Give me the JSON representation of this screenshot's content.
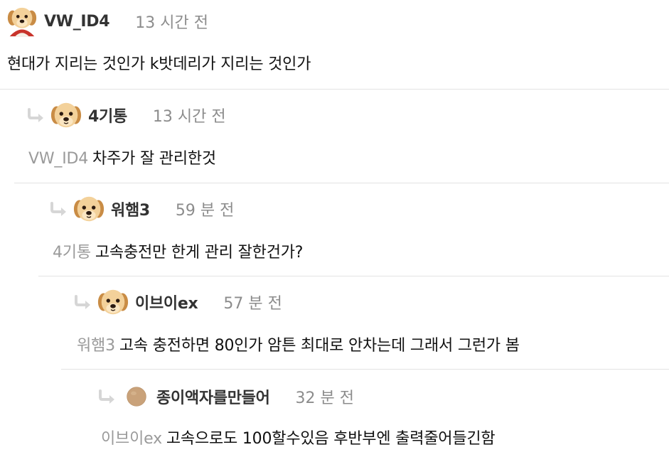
{
  "comments": [
    {
      "author": "VW_ID4",
      "time": "13 시간 전",
      "mention": "",
      "text": "현대가 지리는 것인가 k밧데리가 지리는 것인가",
      "avatar": "puppy-king-icon",
      "depth": 0
    },
    {
      "author": "4기통",
      "time": "13 시간 전",
      "mention": "VW_ID4",
      "text": "차주가 잘 관리한것",
      "avatar": "puppy-icon",
      "depth": 1
    },
    {
      "author": "워햄3",
      "time": "59 분 전",
      "mention": "4기통",
      "text": "고속충전만 한게 관리 잘한건가?",
      "avatar": "puppy-icon",
      "depth": 2
    },
    {
      "author": "이브이ex",
      "time": "57 분 전",
      "mention": "워햄3",
      "text": "고속 충전하면 80인가 암튼 최대로 안차는데 그래서 그런가 봄",
      "avatar": "puppy-icon",
      "depth": 3
    },
    {
      "author": "종이액자를만들어",
      "time": "32 분 전",
      "mention": "이브이ex",
      "text": "고속으로도 100할수있음 후반부엔 출력줄어들긴함",
      "avatar": "egg-avatar-icon",
      "depth": 4
    }
  ],
  "colors": {
    "divider": "#e3e3e3",
    "mention": "#9a9a9a",
    "time": "#8c8c8c",
    "reply_arrow": "#d6d6d6"
  }
}
